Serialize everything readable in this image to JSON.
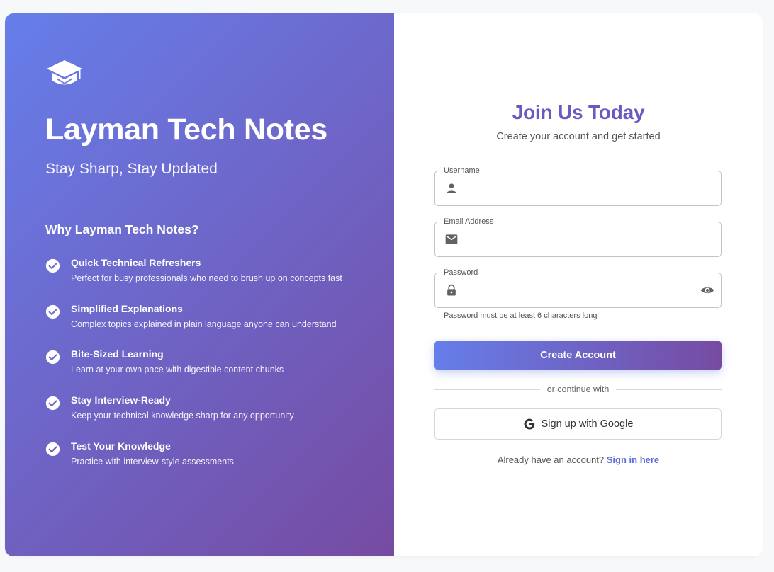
{
  "brand": {
    "icon": "graduation-cap-icon",
    "title": "Layman Tech Notes",
    "tagline": "Stay Sharp, Stay Updated"
  },
  "why": {
    "heading": "Why Layman Tech Notes?",
    "features": [
      {
        "title": "Quick Technical Refreshers",
        "desc": "Perfect for busy professionals who need to brush up on concepts fast"
      },
      {
        "title": "Simplified Explanations",
        "desc": "Complex topics explained in plain language anyone can understand"
      },
      {
        "title": "Bite-Sized Learning",
        "desc": "Learn at your own pace with digestible content chunks"
      },
      {
        "title": "Stay Interview-Ready",
        "desc": "Keep your technical knowledge sharp for any opportunity"
      },
      {
        "title": "Test Your Knowledge",
        "desc": "Practice with interview-style assessments"
      }
    ]
  },
  "form": {
    "title": "Join Us Today",
    "subtitle": "Create your account and get started",
    "username": {
      "label": "Username",
      "value": "",
      "icon": "person-icon"
    },
    "email": {
      "label": "Email Address",
      "value": "",
      "icon": "email-icon"
    },
    "password": {
      "label": "Password",
      "value": "",
      "icon": "lock-icon",
      "toggle_icon": "eye-icon",
      "helper": "Password must be at least 6 characters long"
    },
    "submit_label": "Create Account",
    "divider_text": "or continue with",
    "google_label": "Sign up with Google",
    "signin_prompt": "Already have an account?",
    "signin_link": "Sign in here"
  },
  "colors": {
    "gradient_start": "#667eea",
    "gradient_end": "#764ba2",
    "title_color": "#6a5ac0",
    "link_color": "#5b6fd6"
  }
}
